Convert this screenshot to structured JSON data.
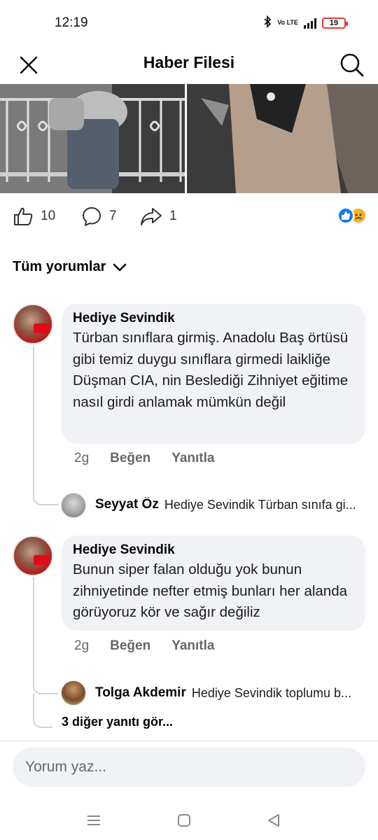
{
  "status_bar": {
    "time": "12:19",
    "network_label": "Vo LTE",
    "battery_level": "19",
    "battery_color": "#e53935"
  },
  "header": {
    "title": "Haber Filesi",
    "close_icon": "close-icon",
    "search_icon": "search-icon"
  },
  "post_stats": {
    "likes": "10",
    "comments": "7",
    "shares": "1",
    "reaction_icons": [
      "like-reaction-icon",
      "sad-reaction-icon"
    ]
  },
  "comments_filter": {
    "label": "Tüm yorumlar"
  },
  "comments": [
    {
      "author": "Hediye Sevindik",
      "text": "Türban sınıflara girmiş. Anadolu Baş örtüsü gibi temiz duygu sınıflara girmedi laikliğe Düşman CIA, nin Beslediği Zihniyet eğitime nasıl girdi anlamak mümkün değil",
      "time": "2g",
      "like_label": "Beğen",
      "reply_label": "Yanıtla",
      "reply_preview": {
        "author": "Seyyat Öz",
        "text": "Hediye Sevindik Türban sınıfa gi..."
      }
    },
    {
      "author": "Hediye Sevindik",
      "text": "Bunun siper falan olduğu yok bunun zihniyetinde nefter etmiş bunları  her alanda görüyoruz kör ve sağır değiliz",
      "time": "2g",
      "like_label": "Beğen",
      "reply_label": "Yanıtla",
      "reply_preview": {
        "author": "Tolga Akdemir",
        "text": "Hediye Sevindik toplumu b..."
      },
      "more_replies": "3 diğer yanıtı gör..."
    }
  ],
  "composer": {
    "placeholder": "Yorum yaz..."
  },
  "nav": {
    "menu_icon": "menu-icon",
    "home_icon": "home-icon",
    "back_icon": "back-icon"
  },
  "colors": {
    "brand_blue": "#1877f2",
    "bubble_bg": "#f0f2f5",
    "meta_gray": "#65676b"
  }
}
